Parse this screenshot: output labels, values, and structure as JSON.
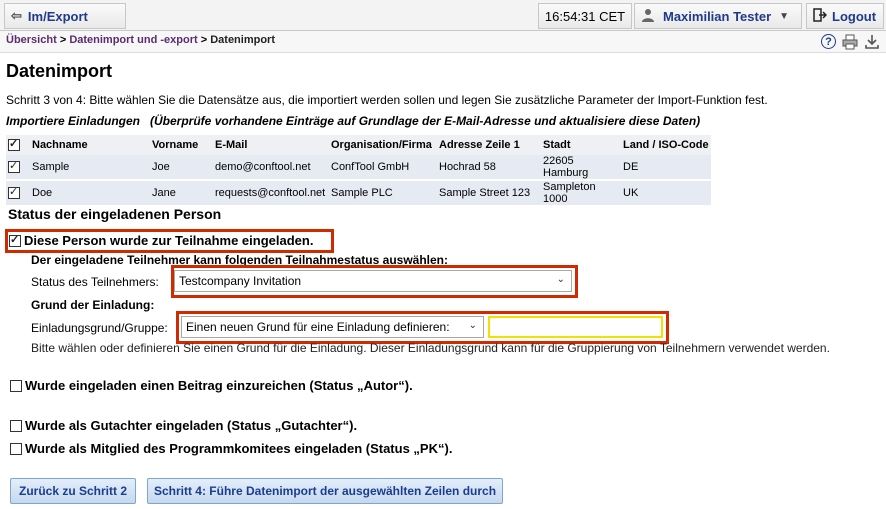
{
  "topbar": {
    "back_label": "Im/Export",
    "time": "16:54:31 CET",
    "user": "Maximilian Tester",
    "logout": "Logout"
  },
  "breadcrumb": {
    "items": [
      "Übersicht",
      "Datenimport und -export"
    ],
    "current": "Datenimport",
    "separator": ">"
  },
  "page": {
    "title": "Datenimport",
    "intro": "Schritt 3 von 4: Bitte wählen Sie die Datensätze aus, die importiert werden sollen und legen Sie zusätzliche Parameter der Import-Funktion fest.",
    "subheading": "Importiere Einladungen   (Überprüfe vorhandene Einträge auf Grundlage der E-Mail-Adresse und aktualisiere diese Daten)"
  },
  "table": {
    "headers": [
      "Nachname",
      "Vorname",
      "E-Mail",
      "Organisation/Firma",
      "Adresse Zeile 1",
      "Stadt",
      "Land / ISO-Code"
    ],
    "rows": [
      [
        "Sample",
        "Joe",
        "demo@conftool.net",
        "ConfTool GmbH",
        "Hochrad 58",
        "22605 Hamburg",
        "DE"
      ],
      [
        "Doe",
        "Jane",
        "requests@conftool.net",
        "Sample PLC",
        "Sample Street 123",
        "Sampleton 1000",
        "UK"
      ]
    ]
  },
  "status": {
    "heading": "Status der eingeladenen Person",
    "invited_label": "Diese Person wurde zur Teilnahme eingeladen.",
    "status_intro": "Der eingeladene Teilnehmer kann folgenden Teilnahmestatus auswählen:",
    "status_label": "Status des Teilnehmers:",
    "status_value": "Testcompany Invitation",
    "reason_heading": "Grund der Einladung:",
    "reason_label": "Einladungsgrund/Gruppe:",
    "reason_value": "Einen neuen Grund für eine Einladung definieren:",
    "reason_text": "",
    "note": "Bitte wählen oder definieren Sie einen Grund für die Einladung. Dieser Einladungsgrund kann für die Gruppierung von Teilnehmern verwendet werden.",
    "author_pre": "Wurde eingeladen einen Beitrag einzureichen (Status „",
    "author_key": "Autor",
    "author_post": "“).",
    "reviewer_pre": "Wurde als Gutachter eingeladen (Status „",
    "reviewer_key": "Gutachter",
    "reviewer_post": "“).",
    "pc_pre": "Wurde als Mitglied des Programmkomitees eingeladen (Status „",
    "pc_key": "PK",
    "pc_post": "“)."
  },
  "buttons": {
    "back": "Zurück zu Schritt 2",
    "next": "Schritt 4: Führe Datenimport der ausgewählten Zeilen durch"
  },
  "colors": {
    "highlight_border": "#d22a00",
    "input_border": "#f2e000",
    "link": "#1f3a8a"
  }
}
